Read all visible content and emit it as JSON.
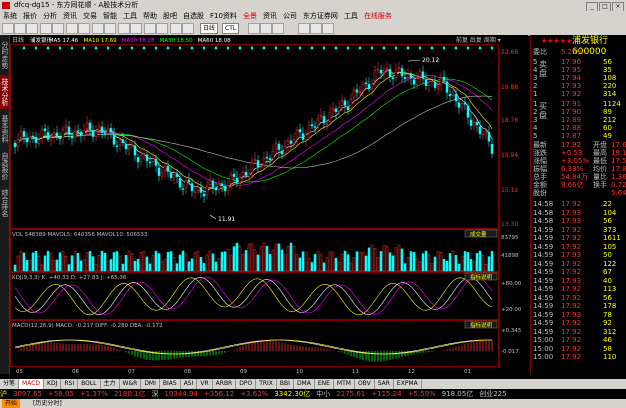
{
  "window": {
    "title": "dfcq-dg15 - 东方同花顺 - A股技术分析"
  },
  "menu": [
    "系统",
    "报价",
    "分析",
    "资讯",
    "交易",
    "智能",
    "工具",
    "帮助",
    "股吧",
    "自选股",
    "F10资料",
    "全景",
    "资讯",
    "公司",
    "东方证券网",
    "工具",
    "在线服务"
  ],
  "menu_highlight": [
    "全景",
    "在线服务"
  ],
  "toolbar": {
    "period_label": "日线",
    "ctl_label": "CTL"
  },
  "lefttabs": [
    "分时走势",
    "技术分析",
    "基本资料",
    "自选报价",
    "综合排名"
  ],
  "lefttabs_active": 1,
  "main": {
    "header_left": "日线",
    "legend": [
      {
        "label": "浦发银行",
        "color": "#ffffff"
      },
      {
        "label": "MA5 17.46",
        "color": "#ffffff"
      },
      {
        "label": "MA10 17.69",
        "color": "#ffff00"
      },
      {
        "label": "MA20 18.28",
        "color": "#ff00ff"
      },
      {
        "label": "MA30 18.50",
        "color": "#00ff00"
      },
      {
        "label": "MA60 18.08",
        "color": "#ffffff"
      }
    ],
    "header_right": "前复 后复 周期 ▾",
    "price_ticks": [
      "22.68",
      "19.88",
      "18.76",
      "15.94",
      "15.12",
      "13.30"
    ],
    "high_label": "20.12",
    "low_label": "11.91",
    "vol": {
      "label": "VOL 548389  MAVOL5: 640356  MAVOL10: 506533",
      "button": "成交量",
      "ticks": [
        "83795",
        "41898"
      ]
    },
    "kdj": {
      "label": "KDJ(9,3,3) K: +40.33  D: +27.83  J: +65.36",
      "button": "指标说明",
      "ticks": [
        "+80.00",
        "+20.00"
      ]
    },
    "macd": {
      "label": "MACD(12,26,9) MACD: -0.217  DIFF: -0.280  DEA: -0.172",
      "button": "指标说明",
      "ticks": [
        "+0.345",
        "-0.017"
      ]
    },
    "x_ticks": [
      "05",
      "06",
      "07",
      "08",
      "09",
      "10",
      "11",
      "12",
      "01"
    ]
  },
  "right": {
    "title": "浦发银行 600000",
    "stars": "★★★★★",
    "weibi_label": "委比",
    "weibi_val": "5.25%",
    "sell_label": "卖盘",
    "sell": [
      {
        "n": "5",
        "p": "17.96",
        "v": "56"
      },
      {
        "n": "4",
        "p": "17.95",
        "v": "35"
      },
      {
        "n": "3",
        "p": "17.94",
        "v": "108"
      },
      {
        "n": "2",
        "p": "17.93",
        "v": "220"
      },
      {
        "n": "1",
        "p": "17.92",
        "v": "314"
      }
    ],
    "buy_label": "买盘",
    "buy": [
      {
        "n": "1",
        "p": "17.91",
        "v": "1124"
      },
      {
        "n": "2",
        "p": "17.90",
        "v": "89"
      },
      {
        "n": "3",
        "p": "17.89",
        "v": "212"
      },
      {
        "n": "4",
        "p": "17.88",
        "v": "60"
      },
      {
        "n": "5",
        "p": "17.87",
        "v": "49"
      }
    ],
    "stats": [
      {
        "k": "最新",
        "v": "17.92",
        "k2": "开盘",
        "v2": "17.68"
      },
      {
        "k": "涨跌",
        "v": "+0.53",
        "k2": "最高",
        "v2": "18.10"
      },
      {
        "k": "涨幅",
        "v": "+3.05%",
        "k2": "最低",
        "v2": "17.52"
      },
      {
        "k": "振幅",
        "v": "6.33%",
        "k2": "均价",
        "v2": "17.82"
      },
      {
        "k": "总手",
        "v": "54.84万",
        "k2": "量比",
        "v2": "1.36"
      },
      {
        "k": "金额",
        "v": "9.66亿",
        "k2": "换手",
        "v2": "0.72%"
      },
      {
        "k": "股份",
        "v": "",
        "k2": "",
        "v2": "5.64%"
      }
    ],
    "ticks": [
      {
        "t": "14:58",
        "p": "17.92",
        "v": "22"
      },
      {
        "t": "14:58",
        "p": "17.93",
        "v": "104"
      },
      {
        "t": "14:58",
        "p": "17.93",
        "v": "56"
      },
      {
        "t": "14:59",
        "p": "17.92",
        "v": "373"
      },
      {
        "t": "14:59",
        "p": "17.92",
        "v": "1611"
      },
      {
        "t": "14:59",
        "p": "17.92",
        "v": "105"
      },
      {
        "t": "14:59",
        "p": "17.93",
        "v": "50"
      },
      {
        "t": "14:59",
        "p": "17.92",
        "v": "122"
      },
      {
        "t": "14:59",
        "p": "17.92",
        "v": "67"
      },
      {
        "t": "14:59",
        "p": "17.93",
        "v": "40"
      },
      {
        "t": "14:59",
        "p": "17.92",
        "v": "113"
      },
      {
        "t": "14:59",
        "p": "17.92",
        "v": "56"
      },
      {
        "t": "14:59",
        "p": "17.92",
        "v": "178"
      },
      {
        "t": "14:59",
        "p": "17.93",
        "v": "78"
      },
      {
        "t": "14:59",
        "p": "17.92",
        "v": "92"
      },
      {
        "t": "14:59",
        "p": "17.92",
        "v": "312"
      },
      {
        "t": "15:00",
        "p": "17.92",
        "v": "46"
      },
      {
        "t": "15:00",
        "p": "17.92",
        "v": "58"
      },
      {
        "t": "15:00",
        "p": "17.92",
        "v": "110"
      }
    ]
  },
  "bottomtabs": [
    "分笔",
    "MACD",
    "KDJ",
    "RSI",
    "BOLL",
    "主力",
    "W&R",
    "DMI",
    "BIAS",
    "ASI",
    "VR",
    "ARBR",
    "DPO",
    "TRIX",
    "BBI",
    "DMA",
    "ENE",
    "MTM",
    "OBV",
    "SAR",
    "EXPMA"
  ],
  "bottomtabs_active": 1,
  "status": [
    {
      "c": "y",
      "t": "沪"
    },
    {
      "c": "r",
      "t": "3097.65"
    },
    {
      "c": "r",
      "t": "+58.05"
    },
    {
      "c": "r",
      "t": "+1.37%"
    },
    {
      "c": "r",
      "t": "2180.1亿"
    },
    {
      "c": "w",
      "t": "深"
    },
    {
      "c": "r",
      "t": "10344.94"
    },
    {
      "c": "r",
      "t": "+356.12"
    },
    {
      "c": "r",
      "t": "+3.62%"
    },
    {
      "c": "y",
      "t": "3342.30亿"
    },
    {
      "c": "w",
      "t": "中小"
    },
    {
      "c": "r",
      "t": "2175.61"
    },
    {
      "c": "r",
      "t": "+115.24"
    },
    {
      "c": "r",
      "t": "+5.59%"
    },
    {
      "c": "w",
      "t": "918.05亿"
    },
    {
      "c": "w",
      "t": "创业225"
    }
  ],
  "taskbar": {
    "btn": "开始",
    "item": "[历史分时]"
  }
}
